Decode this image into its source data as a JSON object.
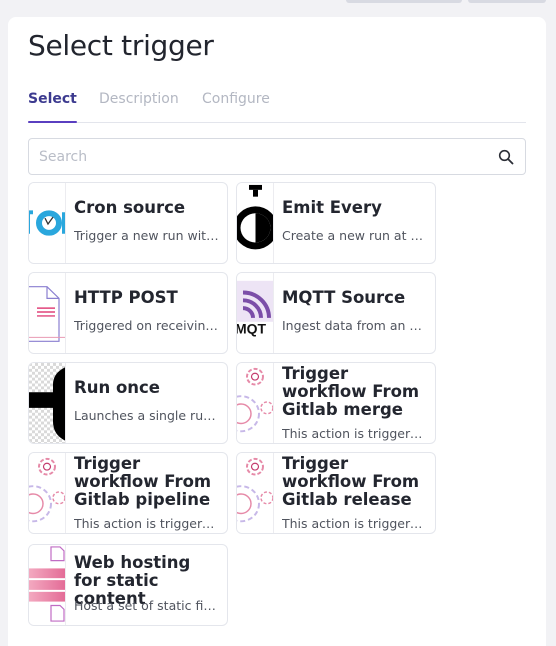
{
  "dialog": {
    "title": "Select trigger",
    "tabs": [
      "Select",
      "Description",
      "Configure"
    ]
  },
  "search": {
    "placeholder": "Search",
    "value": ""
  },
  "cards": [
    {
      "title": "Cron source",
      "description": "Trigger a new run with …",
      "thumb": "cron-source-thumbnail-icon"
    },
    {
      "title": "Emit Every",
      "description": "Create a new run at a gi…",
      "thumb": "emit-every-thumbnail-icon"
    },
    {
      "title": "HTTP POST",
      "description": "Triggered on receiving …",
      "thumb": "http-post-thumbnail-icon"
    },
    {
      "title": "MQTT Source",
      "description": "Ingest data from an MQ…",
      "thumb": "mqtt-source-thumbnail-icon"
    },
    {
      "title": "Run once",
      "description": "Launches a single run o…",
      "thumb": "run-once-thumbnail-icon"
    },
    {
      "title": "Trigger workflow From Gitlab merge",
      "description": "This action is triggered …",
      "thumb": "gear-thumbnail-icon"
    },
    {
      "title": "Trigger workflow From Gitlab pipeline",
      "description": "This action is triggered …",
      "thumb": "gear-thumbnail-icon"
    },
    {
      "title": "Trigger workflow From Gitlab release",
      "description": "This action is triggered …",
      "thumb": "gear-thumbnail-icon"
    },
    {
      "title": "Web hosting for static content",
      "description": "Host a set of static file …",
      "thumb": "web-hosting-thumbnail-icon"
    }
  ],
  "colors": {
    "accent": "#5a3fc0",
    "active_tab": "#3c3a8f",
    "thumb_pink": "#e9a0b8"
  }
}
